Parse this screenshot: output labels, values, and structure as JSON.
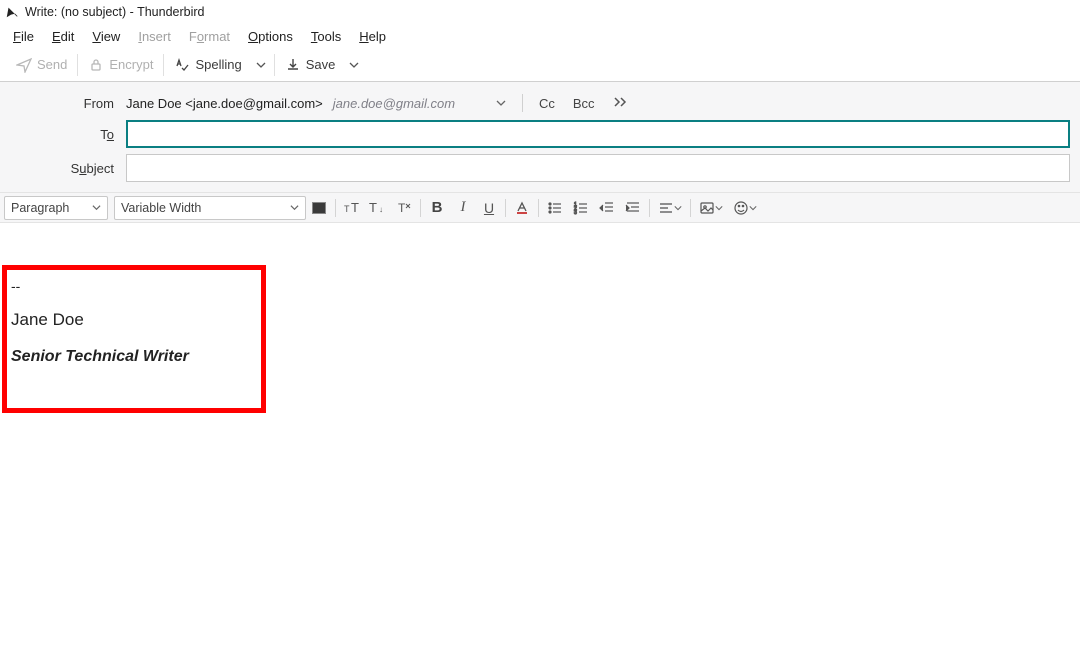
{
  "window": {
    "title": "Write: (no subject) - Thunderbird"
  },
  "menu": {
    "file": {
      "pre": "",
      "u": "F",
      "post": "ile"
    },
    "edit": {
      "pre": "",
      "u": "E",
      "post": "dit"
    },
    "view": {
      "pre": "",
      "u": "V",
      "post": "iew"
    },
    "insert": {
      "pre": "",
      "u": "I",
      "post": "nsert"
    },
    "format": {
      "pre": "F",
      "u": "o",
      "post": "rmat"
    },
    "options": {
      "pre": "",
      "u": "O",
      "post": "ptions"
    },
    "tools": {
      "pre": "",
      "u": "T",
      "post": "ools"
    },
    "help": {
      "pre": "",
      "u": "H",
      "post": "elp"
    }
  },
  "toolbar": {
    "send": "Send",
    "encrypt": "Encrypt",
    "spelling": "Spelling",
    "save": "Save"
  },
  "addr": {
    "from_label": "From",
    "from_value": "Jane Doe <jane.doe@gmail.com>",
    "from_identity": "jane.doe@gmail.com",
    "cc": "Cc",
    "bcc": "Bcc",
    "to_pre": "T",
    "to_u": "o",
    "subj_pre": "S",
    "subj_u": "u",
    "subj_post": "bject"
  },
  "fmt": {
    "paragraph": "Paragraph",
    "font": "Variable Width"
  },
  "signature": {
    "separator": "--",
    "name": "Jane Doe",
    "title": "Senior Technical Writer"
  }
}
